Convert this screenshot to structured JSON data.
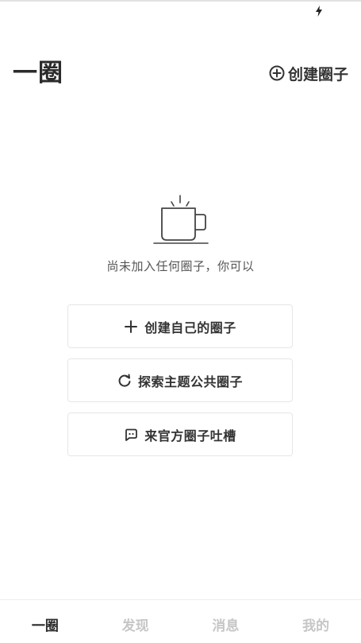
{
  "status_bar": {
    "charge_icon": "lightning-bolt-icon"
  },
  "header": {
    "title": "一圈",
    "create_icon": "plus-circle-icon",
    "create_label": "创建圈子"
  },
  "empty_state": {
    "icon": "coffee-cup-icon",
    "text": "尚未加入任何圈子，你可以"
  },
  "actions": [
    {
      "icon": "plus-icon",
      "label": "创建自己的圈子"
    },
    {
      "icon": "refresh-icon",
      "label": "探索主题公共圈子"
    },
    {
      "icon": "chat-bubble-icon",
      "label": "来官方圈子吐槽"
    }
  ],
  "tabs": [
    {
      "label": "一圈",
      "active": true
    },
    {
      "label": "发现",
      "active": false
    },
    {
      "label": "消息",
      "active": false
    },
    {
      "label": "我的",
      "active": false
    }
  ],
  "colors": {
    "text_primary": "#333333",
    "title": "#2b2b2b",
    "tab_inactive": "#c6c6c6",
    "border": "#e6e6e6"
  }
}
